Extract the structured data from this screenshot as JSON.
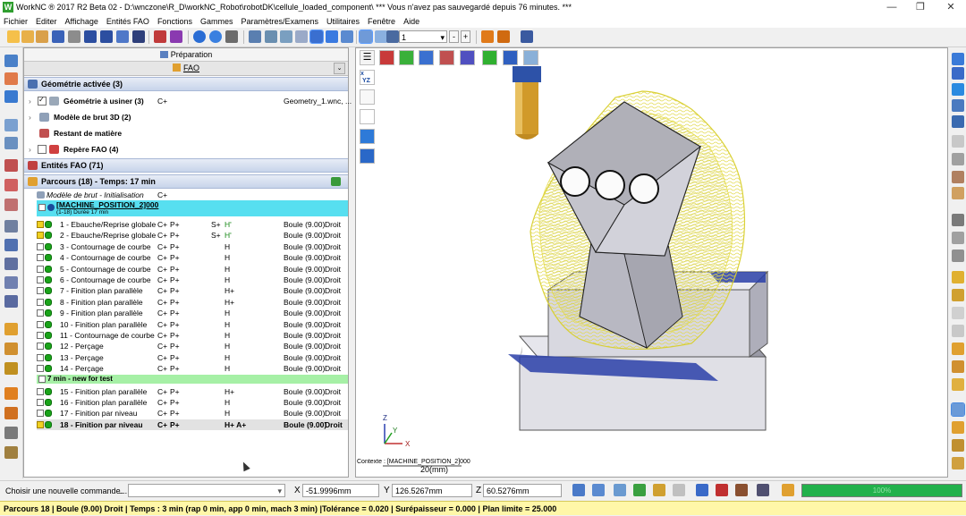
{
  "window": {
    "title": "WorkNC ® 2017 R2 Beta 02 - D:\\wnczone\\R_D\\workNC_Robot\\robotDK\\cellule_loaded_component\\ *** Vous n'avez pas sauvegardé depuis 76 minutes. ***",
    "logo_letter": "W",
    "minimize": "—",
    "maximize": "❐",
    "close": "✕"
  },
  "menu": [
    "Fichier",
    "Editer",
    "Affichage",
    "Entités FAO",
    "Fonctions",
    "Gammes",
    "Paramètres/Examens",
    "Utilitaires",
    "Fenêtre",
    "Aide"
  ],
  "toolbar": {
    "position_value": "1",
    "dropdown_arrow": "▾",
    "minus": "-",
    "plus": "+"
  },
  "panel": {
    "header": "Préparation",
    "subheader": "FAO",
    "sections": {
      "geometry": "Géométrie activée (3)",
      "entities": "Entités FAO (71)",
      "toolpaths": "Parcours (18) - Temps: 17 min"
    },
    "geometry_items": [
      {
        "label": "Géométrie à usiner (3)",
        "col2": "C+",
        "col3": "Geometry_1.wnc, ..."
      },
      {
        "label": "Modèle de brut 3D (2)",
        "col2": "",
        "col3": ""
      },
      {
        "label": "Restant de matière",
        "col2": "",
        "col3": ""
      },
      {
        "label": "Repère FAO (4)",
        "col2": "",
        "col3": ""
      }
    ],
    "stock_model": {
      "label": "Modèle de brut - Initialisation",
      "col2": "C+"
    },
    "group1": {
      "title": "[MACHINE_POSITION_2]000",
      "subtitle": "(1-18) Durée 17 min"
    },
    "group2": {
      "title": "7 min - new for test"
    },
    "toolpaths": [
      {
        "label": "1 - Ebauche/Reprise globale",
        "c1": "C+",
        "c2": "P+",
        "c3": "S+",
        "c4": "H'",
        "tool": "Boule (9.00)",
        "dir": "Droit"
      },
      {
        "label": "2 - Ebauche/Reprise globale",
        "c1": "C+",
        "c2": "P+",
        "c3": "S+",
        "c4": "H'",
        "tool": "Boule (9.00)",
        "dir": "Droit"
      },
      {
        "label": "3 - Contournage de courbe",
        "c1": "C+",
        "c2": "P+",
        "c3": "",
        "c4": "H",
        "tool": "Boule (9.00)",
        "dir": "Droit"
      },
      {
        "label": "4 - Contournage de courbe",
        "c1": "C+",
        "c2": "P+",
        "c3": "",
        "c4": "H",
        "tool": "Boule (9.00)",
        "dir": "Droit"
      },
      {
        "label": "5 - Contournage de courbe",
        "c1": "C+",
        "c2": "P+",
        "c3": "",
        "c4": "H",
        "tool": "Boule (9.00)",
        "dir": "Droit"
      },
      {
        "label": "6 - Contournage de courbe",
        "c1": "C+",
        "c2": "P+",
        "c3": "",
        "c4": "H",
        "tool": "Boule (9.00)",
        "dir": "Droit"
      },
      {
        "label": "7 - Finition plan parallèle",
        "c1": "C+",
        "c2": "P+",
        "c3": "",
        "c4": "H+",
        "tool": "Boule (9.00)",
        "dir": "Droit"
      },
      {
        "label": "8 - Finition plan parallèle",
        "c1": "C+",
        "c2": "P+",
        "c3": "",
        "c4": "H+",
        "tool": "Boule (9.00)",
        "dir": "Droit"
      },
      {
        "label": "9 - Finition plan parallèle",
        "c1": "C+",
        "c2": "P+",
        "c3": "",
        "c4": "H",
        "tool": "Boule (9.00)",
        "dir": "Droit"
      },
      {
        "label": "10 - Finition plan parallèle",
        "c1": "C+",
        "c2": "P+",
        "c3": "",
        "c4": "H",
        "tool": "Boule (9.00)",
        "dir": "Droit"
      },
      {
        "label": "11 - Contournage de courbe",
        "c1": "C+",
        "c2": "P+",
        "c3": "",
        "c4": "H",
        "tool": "Boule (9.00)",
        "dir": "Droit"
      },
      {
        "label": "12 - Perçage",
        "c1": "C+",
        "c2": "P+",
        "c3": "",
        "c4": "H",
        "tool": "Boule (9.00)",
        "dir": "Droit"
      },
      {
        "label": "13 - Perçage",
        "c1": "C+",
        "c2": "P+",
        "c3": "",
        "c4": "H",
        "tool": "Boule (9.00)",
        "dir": "Droit"
      },
      {
        "label": "14 - Perçage",
        "c1": "C+",
        "c2": "P+",
        "c3": "",
        "c4": "H",
        "tool": "Boule (9.00)",
        "dir": "Droit"
      },
      {
        "label": "15 - Finition plan parallèle",
        "c1": "C+",
        "c2": "P+",
        "c3": "",
        "c4": "H+",
        "tool": "Boule (9.00)",
        "dir": "Droit"
      },
      {
        "label": "16 - Finition plan parallèle",
        "c1": "C+",
        "c2": "P+",
        "c3": "",
        "c4": "H",
        "tool": "Boule (9.00)",
        "dir": "Droit"
      },
      {
        "label": "17 - Finition par niveau",
        "c1": "C+",
        "c2": "P+",
        "c3": "",
        "c4": "H",
        "tool": "Boule (9.00)",
        "dir": "Droit"
      },
      {
        "label": "18 - Finition par niveau",
        "c1": "C+",
        "c2": "P+",
        "c3": "",
        "c4": "H+  A+",
        "tool": "Boule (9.00)",
        "dir": "Droit"
      }
    ]
  },
  "viewport": {
    "context": "Contexte : [MACHINE_POSITION_2]000",
    "scale": "20(mm)",
    "axis_x": "X",
    "axis_y": "Y",
    "axis_z": "Z",
    "view_x": "x",
    "view_y": "Y",
    "view_z": "Z"
  },
  "command": {
    "prompt": "Choisir une nouvelle commande...",
    "dots": "..",
    "x_label": "X",
    "x_value": "-51.9996mm",
    "y_label": "Y",
    "y_value": "126.5267mm",
    "z_label": "Z",
    "z_value": "60.5276mm",
    "progress": "100%"
  },
  "status": "Parcours 18 | Boule (9.00) Droit | Temps : 3 min (rap 0 min, app 0 min, mach 3 min) |Tolérance = 0.020 | Surépaisseur = 0.000 | Plan limite = 25.000"
}
